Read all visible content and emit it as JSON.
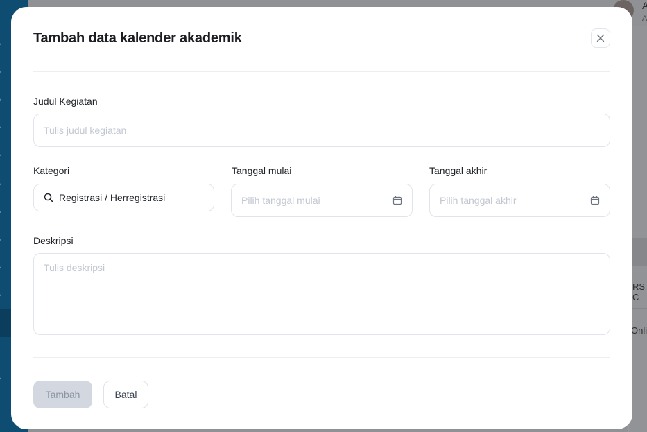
{
  "background": {
    "user_name_fragment": "A",
    "user_sub_fragment": "A",
    "row1_fragment": "RS C",
    "row2_fragment": "Onlin"
  },
  "modal": {
    "title": "Tambah data kalender akademik",
    "close_icon": "close-icon",
    "fields": {
      "judul": {
        "label": "Judul Kegiatan",
        "placeholder": "Tulis judul kegiatan",
        "value": ""
      },
      "kategori": {
        "label": "Kategori",
        "value": "Registrasi / Herregistrasi",
        "icon": "search-icon"
      },
      "tanggal_mulai": {
        "label": "Tanggal mulai",
        "placeholder": "Pilih tanggal mulai",
        "icon": "calendar-icon"
      },
      "tanggal_akhir": {
        "label": "Tanggal akhir",
        "placeholder": "Pilih tanggal akhir",
        "icon": "calendar-icon"
      },
      "deskripsi": {
        "label": "Deskripsi",
        "placeholder": "Tulis deskripsi",
        "value": ""
      }
    },
    "buttons": {
      "submit_label": "Tambah",
      "cancel_label": "Batal"
    }
  },
  "colors": {
    "sidebar": "#0e4c72",
    "overlay": "#8f9195",
    "primary_disabled": "#d3d7df",
    "border": "#e1e4ea",
    "placeholder": "#c2c7d1"
  }
}
